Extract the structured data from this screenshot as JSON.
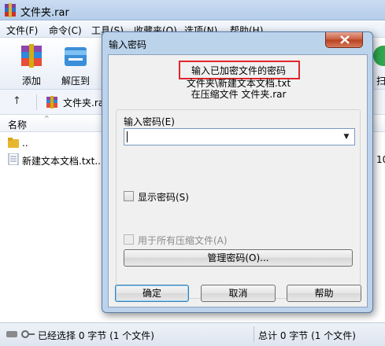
{
  "app": {
    "title": "文件夹.rar",
    "menu": [
      "文件(F)",
      "命令(C)",
      "工具(S)",
      "收藏夹(O)",
      "选项(N)",
      "帮助(H)"
    ],
    "toolbar": [
      "添加",
      "解压到"
    ],
    "toolbar_right_fragment": "扫",
    "path": "文件夹.rar",
    "column_name": "名称",
    "files": [
      {
        "name": ".."
      },
      {
        "name": "新建文本文档.txt..."
      }
    ],
    "right_fragment": "10",
    "status_left": "已经选择 0 字节 (1 个文件)",
    "status_right": "总计 0 字节 (1 个文件)"
  },
  "dialog": {
    "title": "输入密码",
    "prompt": "输入已加密文件的密码",
    "file_line": "文件夹\\新建文本文档.txt",
    "archive_line": "在压缩文件 文件夹.rar",
    "password_label": "输入密码(E)",
    "password_value": "",
    "show_password_label": "显示密码(S)",
    "show_password_checked": false,
    "use_for_all_label": "用于所有压缩文件(A)",
    "use_for_all_checked": false,
    "use_for_all_enabled": false,
    "manage_button": "管理密码(O)...",
    "ok_button": "确定",
    "cancel_button": "取消",
    "help_button": "帮助"
  },
  "colors": {
    "highlight_box": "#e0262d",
    "dialog_frame": "#bcd3ec",
    "close_button": "#c75a3c"
  }
}
